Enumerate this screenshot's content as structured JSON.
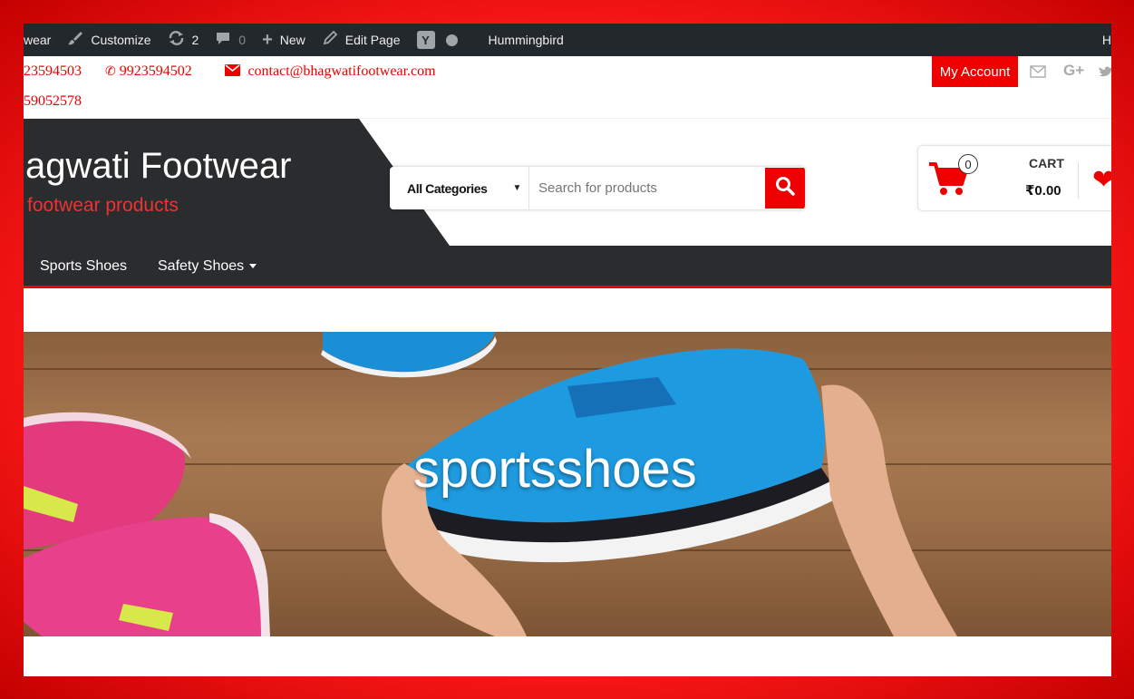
{
  "admin_bar": {
    "site_fragment": "wear",
    "customize": "Customize",
    "updates_count": "2",
    "comments_count": "0",
    "new": "New",
    "edit_page": "Edit Page",
    "hummingbird": "Hummingbird",
    "right_fragment": "H"
  },
  "contact": {
    "phone1_fragment": "23594503",
    "phone2": "9923594502",
    "email": "contact@bhagwatifootwear.com",
    "phone3_fragment": "59052578"
  },
  "top_actions": {
    "my_account": "My Account"
  },
  "brand": {
    "title_fragment": "agwati Footwear",
    "tagline_fragment": "footwear products"
  },
  "search": {
    "category": "All Categories",
    "placeholder": "Search for products"
  },
  "cart": {
    "count": "0",
    "label": "CART",
    "total": "₹0.00"
  },
  "nav": {
    "items": [
      {
        "label": "Sports Shoes"
      },
      {
        "label": "Safety Shoes"
      }
    ]
  },
  "hero": {
    "title": "sportsshoes"
  },
  "colors": {
    "accent": "#e00000",
    "dark": "#2a2c2e",
    "admin_bar": "#23282d"
  }
}
